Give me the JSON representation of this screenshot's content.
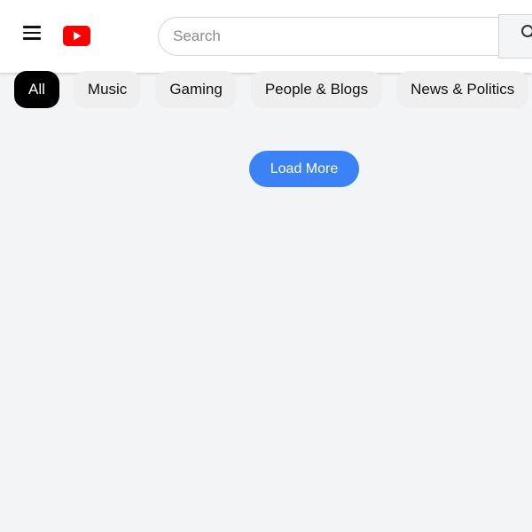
{
  "header": {
    "menu_icon": "hamburger-menu-icon",
    "logo_icon": "youtube-logo-icon",
    "brand_color": "#ff0000"
  },
  "search": {
    "placeholder": "Search",
    "value": "",
    "button_icon": "search-icon"
  },
  "chips": {
    "items": [
      {
        "label": "All",
        "active": true
      },
      {
        "label": "Music",
        "active": false
      },
      {
        "label": "Gaming",
        "active": false
      },
      {
        "label": "People & Blogs",
        "active": false
      },
      {
        "label": "News & Politics",
        "active": false
      }
    ],
    "active_color": "#000000"
  },
  "main": {
    "load_more_label": "Load More",
    "accent_color": "#3b82f6"
  }
}
